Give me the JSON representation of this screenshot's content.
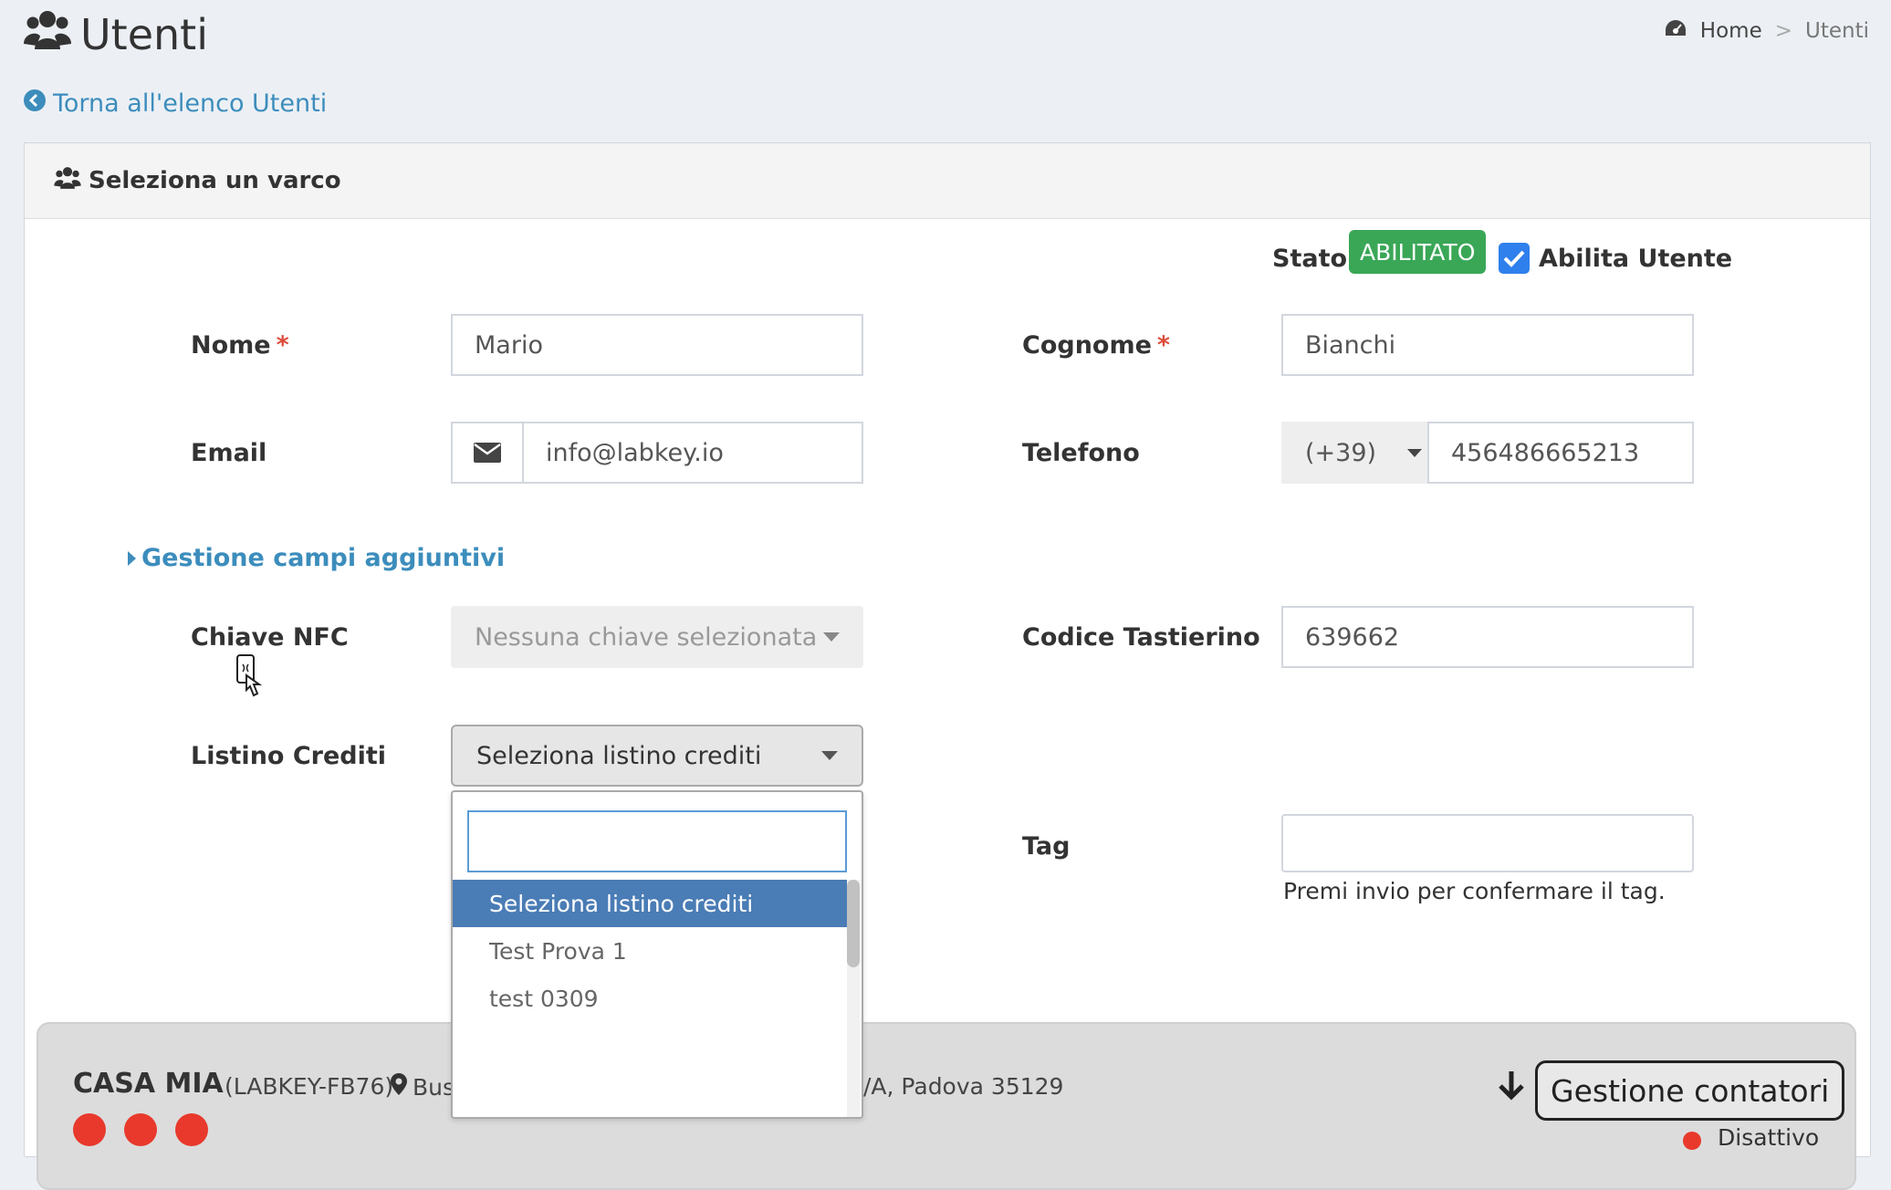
{
  "header": {
    "title": "Utenti",
    "breadcrumb": {
      "home": "Home",
      "separator": ">",
      "current": "Utenti"
    },
    "back_link": "Torna all'elenco Utenti"
  },
  "panel": {
    "title": "Seleziona un varco"
  },
  "status": {
    "label": "Stato:",
    "badge": "ABILITATO",
    "enable_checkbox_label": "Abilita Utente",
    "enable_checked": true
  },
  "form": {
    "nome_label": "Nome",
    "nome_value": "Mario",
    "cognome_label": "Cognome",
    "cognome_value": "Bianchi",
    "required_mark": "*",
    "email_label": "Email",
    "email_value": "info@labkey.io",
    "telefono_label": "Telefono",
    "phone_prefix": "(+39)",
    "phone_value": "456486665213",
    "extra_fields_link": "Gestione campi aggiuntivi",
    "nfc_label": "Chiave NFC",
    "nfc_placeholder": "Nessuna chiave selezionata",
    "keypad_label": "Codice Tastierino",
    "keypad_value": "639662",
    "credits_label": "Listino Crediti",
    "credits_selected": "Seleziona listino crediti",
    "tag_label": "Tag",
    "tag_value": "",
    "tag_help": "Premi invio per confermare il tag."
  },
  "dropdown": {
    "search_value": "",
    "options": [
      "Seleziona listino crediti",
      "Test Prova 1",
      "test 0309"
    ],
    "selected_index": 0
  },
  "card": {
    "name": "CASA MIA",
    "device_id": "(LABKEY-FB76)",
    "address_start": "Bus",
    "address_end": "/A, Padova 35129",
    "button_label": "Gestione contatori",
    "status_text": "Disattivo"
  },
  "colors": {
    "badge_green": "#3aa757",
    "link_blue": "#3c8dbc",
    "dot_red": "#e8392c",
    "selected_blue": "#4a7cb5"
  }
}
